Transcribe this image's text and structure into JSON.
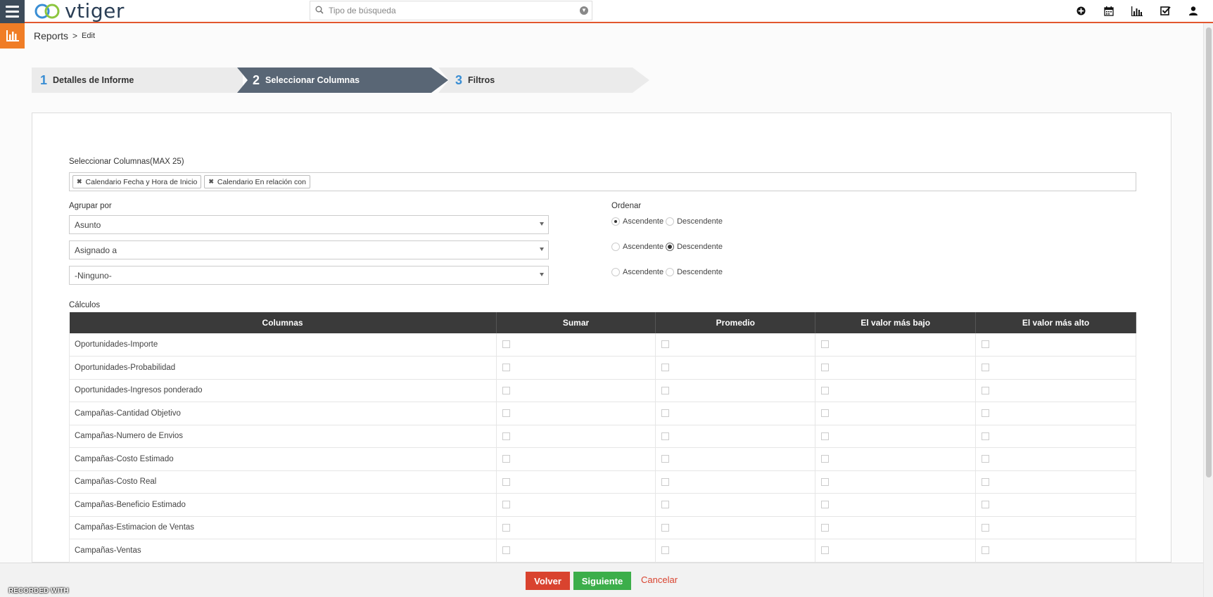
{
  "header": {
    "logo_text": "vtiger",
    "search_placeholder": "Tipo de búsqueda"
  },
  "breadcrumb": {
    "module": "Reports",
    "separator": ">",
    "page": "Edit"
  },
  "steps": [
    {
      "num": "1",
      "label": "Detalles de Informe"
    },
    {
      "num": "2",
      "label": "Seleccionar Columnas"
    },
    {
      "num": "3",
      "label": "Filtros"
    }
  ],
  "form": {
    "select_columns_label": "Seleccionar Columnas(MAX 25)",
    "chips": [
      "Calendario Fecha y Hora de Inicio",
      "Calendario En relación con"
    ],
    "group_by_label": "Agrupar por",
    "group_by": [
      "Asunto",
      "Asignado a",
      "-Ninguno-"
    ],
    "order_label": "Ordenar",
    "order_options": {
      "asc": "Ascendente",
      "desc": "Descendente"
    },
    "order_values": [
      "asc",
      "desc",
      "none"
    ],
    "calc_label": "Cálculos"
  },
  "table": {
    "headers": [
      "Columnas",
      "Sumar",
      "Promedio",
      "El valor más bajo",
      "El valor más alto"
    ],
    "rows": [
      "Oportunidades-Importe",
      "Oportunidades-Probabilidad",
      "Oportunidades-Ingresos ponderado",
      "Campañas-Cantidad Objetivo",
      "Campañas-Numero de Envios",
      "Campañas-Costo Estimado",
      "Campañas-Costo Real",
      "Campañas-Beneficio Estimado",
      "Campañas-Estimacion de Ventas",
      "Campañas-Ventas"
    ]
  },
  "footer": {
    "back": "Volver",
    "next": "Siguiente",
    "cancel": "Cancelar",
    "watermark": "RECORDED WITH"
  },
  "colors": {
    "accent_orange": "#f07d26",
    "header_underline": "#e2572e",
    "active_step": "#596675",
    "btn_back": "#d9432f",
    "btn_next": "#3cae4a"
  }
}
